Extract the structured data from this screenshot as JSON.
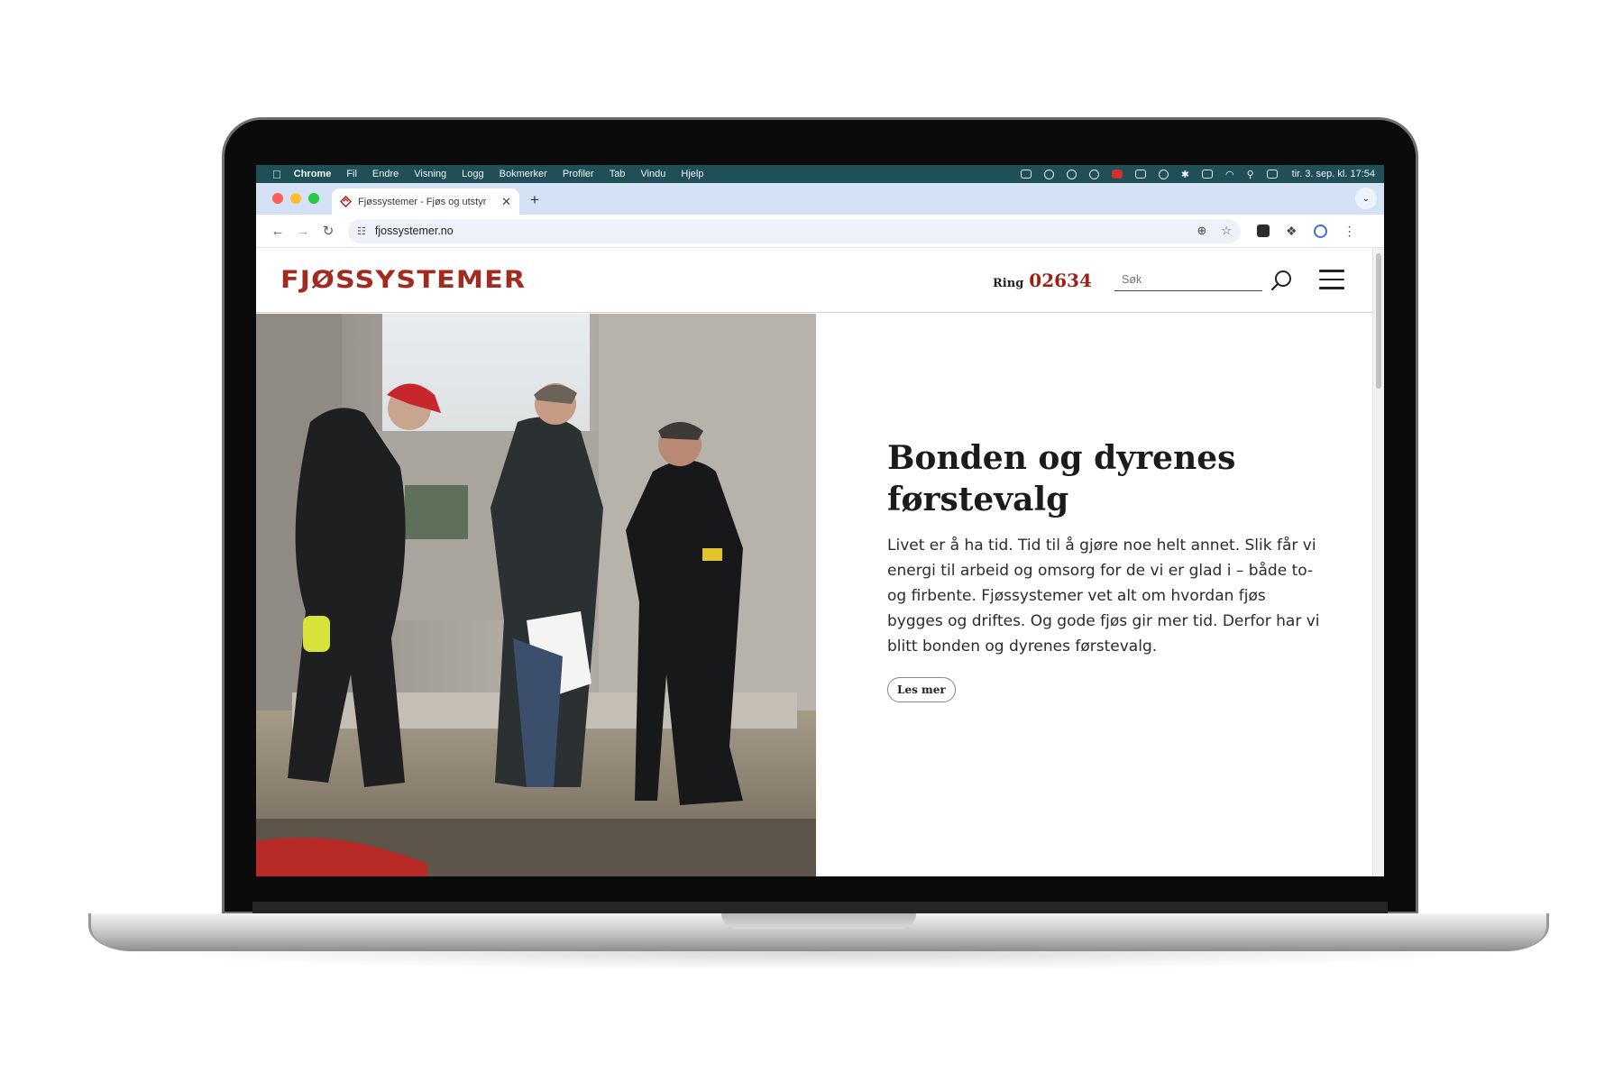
{
  "menubar": {
    "app_name": "Chrome",
    "items": [
      "Fil",
      "Endre",
      "Visning",
      "Logg",
      "Bokmerker",
      "Profiler",
      "Tab",
      "Vindu",
      "Hjelp"
    ],
    "clock": "tir. 3. sep. kl. 17:54"
  },
  "browser": {
    "tab_title": "Fjøssystemer - Fjøs og utstyr",
    "url": "fjossystemer.no",
    "icons": [
      "back-icon",
      "forward-icon",
      "reload-icon",
      "site-settings-icon",
      "zoom-icon",
      "star-icon",
      "extensions-icon",
      "profile-icon",
      "more-icon"
    ]
  },
  "site": {
    "logo": "FJØSSYSTEMER",
    "ring_label": "Ring",
    "ring_number": "02634",
    "search_placeholder": "Søk",
    "accent_color": "#a32a1f"
  },
  "hero": {
    "title_line1": "Bonden og dyrenes",
    "title_line2": "førstevalg",
    "body": "Livet er å ha tid. Tid til å gjøre noe helt annet. Slik får vi energi til arbeid og omsorg for de vi er glad i – både to- og firbente. Fjøssystemer vet alt om hvordan fjøs bygges og driftes. Og gode fjøs gir mer tid. Derfor har vi blitt bonden og dyrenes førstevalg.",
    "cta": "Les mer"
  }
}
